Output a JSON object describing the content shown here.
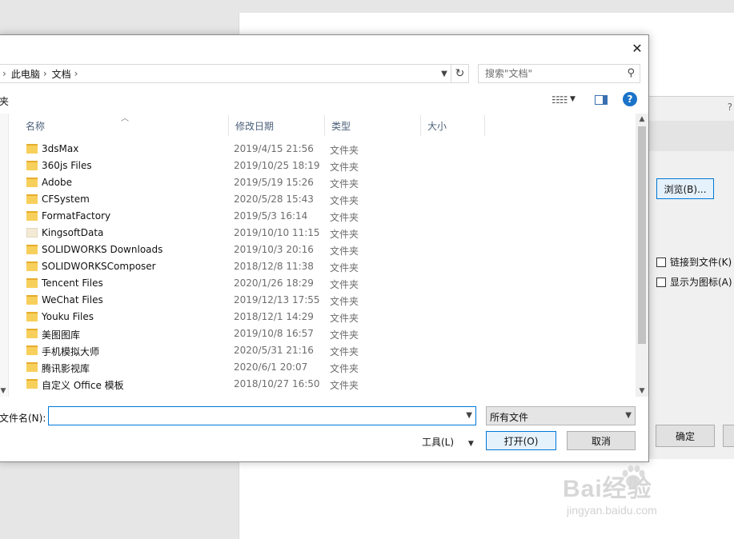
{
  "background": {
    "right_dialog": {
      "help": "?",
      "browse_button": "浏览(B)...",
      "link_checkbox": "链接到文件(K)",
      "icon_checkbox": "显示为图标(A)",
      "ok_button": "确定"
    }
  },
  "dialog": {
    "close_glyph": "✕",
    "breadcrumb": [
      "此电脑",
      "文档"
    ],
    "search_placeholder": "搜索\"文档\"",
    "toolbar": {
      "new_folder_fragment": "夹",
      "help": "?"
    },
    "columns": {
      "name": "名称",
      "date": "修改日期",
      "type": "类型",
      "size": "大小"
    },
    "files": [
      {
        "name": "3dsMax",
        "date": "2019/4/15 21:56",
        "type": "文件夹"
      },
      {
        "name": "360js Files",
        "date": "2019/10/25 18:19",
        "type": "文件夹"
      },
      {
        "name": "Adobe",
        "date": "2019/5/19 15:26",
        "type": "文件夹"
      },
      {
        "name": "CFSystem",
        "date": "2020/5/28 15:43",
        "type": "文件夹"
      },
      {
        "name": "FormatFactory",
        "date": "2019/5/3 16:14",
        "type": "文件夹"
      },
      {
        "name": "KingsoftData",
        "date": "2019/10/10 11:15",
        "type": "文件夹"
      },
      {
        "name": "SOLIDWORKS Downloads",
        "date": "2019/10/3 20:16",
        "type": "文件夹"
      },
      {
        "name": "SOLIDWORKSComposer",
        "date": "2018/12/8 11:38",
        "type": "文件夹"
      },
      {
        "name": "Tencent Files",
        "date": "2020/1/26 18:29",
        "type": "文件夹"
      },
      {
        "name": "WeChat Files",
        "date": "2019/12/13 17:55",
        "type": "文件夹"
      },
      {
        "name": "Youku Files",
        "date": "2018/12/1 14:29",
        "type": "文件夹"
      },
      {
        "name": "美图图库",
        "date": "2019/10/8 16:57",
        "type": "文件夹"
      },
      {
        "name": "手机模拟大师",
        "date": "2020/5/31 21:16",
        "type": "文件夹"
      },
      {
        "name": "腾讯影视库",
        "date": "2020/6/1 20:07",
        "type": "文件夹"
      },
      {
        "name": "自定义 Office 模板",
        "date": "2018/10/27 16:50",
        "type": "文件夹"
      }
    ],
    "filename_label": "文件名(N):",
    "filename_value": "",
    "filter": "所有文件",
    "tools": "工具(L)",
    "open_button": "打开(O)",
    "cancel_button": "取消"
  },
  "watermark": {
    "logo": "Bai经验",
    "url": "jingyan.baidu.com"
  }
}
